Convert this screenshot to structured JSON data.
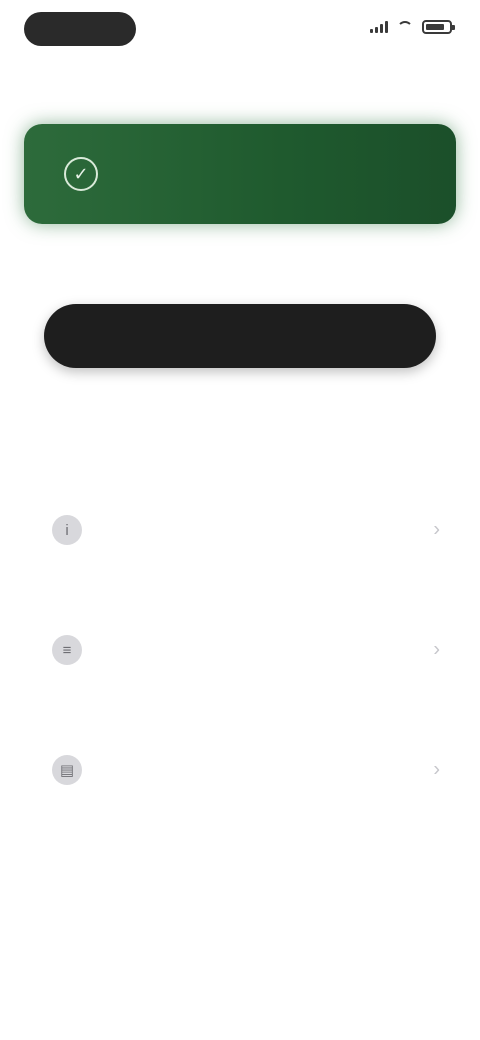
{
  "status_bar": {
    "time": "",
    "icons": [
      "signal-icon",
      "wifi-icon",
      "battery-icon"
    ]
  },
  "nav": {
    "left_label": "",
    "right_label": ""
  },
  "banner": {
    "icon": "check-circle-icon",
    "title": "",
    "subtitle": "",
    "color": "#2d6b3b"
  },
  "section": {
    "label": ""
  },
  "primary_button": {
    "label": ""
  },
  "secondary_link": {
    "label": ""
  },
  "list": {
    "items": [
      {
        "icon": "info-icon",
        "title": "",
        "subtitle": ""
      },
      {
        "icon": "menu-icon",
        "title": "",
        "subtitle": ""
      },
      {
        "icon": "document-icon",
        "title": "",
        "subtitle": ""
      }
    ]
  }
}
